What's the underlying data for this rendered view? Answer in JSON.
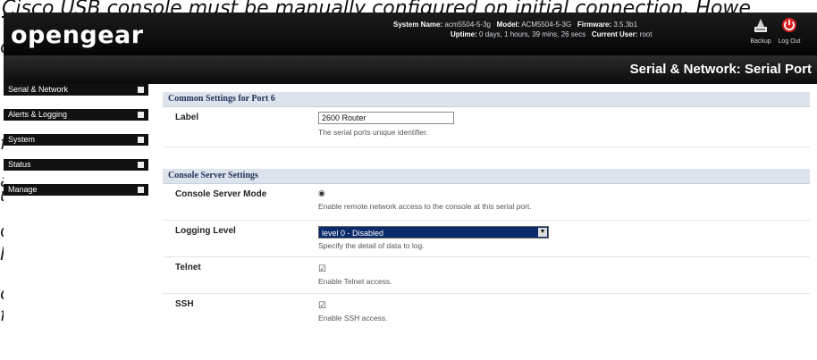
{
  "background_doc": {
    "line1": "Cisco USB console must be manually configured on initial connection. Howe",
    "frag1": "c",
    "frag2": "f",
    "frag3": "a",
    "frag4": "u",
    "frag5": "o",
    "frag6": "I",
    "frag7": "c",
    "frag8": "f"
  },
  "header": {
    "logo": "opengear",
    "system_name_label": "System Name:",
    "system_name": "acm5504-5-3g",
    "model_label": "Model:",
    "model": "ACM5504-5-3G",
    "firmware_label": "Firmware:",
    "firmware": "3.5.3b1",
    "uptime_label": "Uptime:",
    "uptime": "0 days, 1 hours, 39 mins, 26 secs",
    "current_user_label": "Current User:",
    "current_user": "root",
    "backup_label": "Backup",
    "logout_label": "Log Out"
  },
  "title_bar": {
    "title": "Serial & Network: Serial Port"
  },
  "sidebar": {
    "items": [
      {
        "label": "Serial & Network"
      },
      {
        "label": "Alerts & Logging"
      },
      {
        "label": "System"
      },
      {
        "label": "Status"
      },
      {
        "label": "Manage"
      }
    ]
  },
  "common": {
    "heading": "Common Settings for Port 6",
    "label_label": "Label",
    "label_value": "2600 Router",
    "label_help": "The serial ports unique identifier."
  },
  "console": {
    "heading": "Console Server Settings",
    "mode_label": "Console Server Mode",
    "mode_help": "Enable remote network access to the console at this serial port.",
    "logging_label": "Logging Level",
    "logging_value": "level 0 - Disabled",
    "logging_help": "Specify the detail of data to log.",
    "telnet_label": "Telnet",
    "telnet_help": "Enable Telnet access.",
    "ssh_label": "SSH",
    "ssh_help": "Enable SSH access."
  },
  "colors": {
    "header_bg": "#0b0b0b",
    "section_bg": "#dde3ec",
    "select_bg": "#0a2a6a",
    "logout_icon": "#d92020"
  },
  "icons": {
    "backup": "backup-icon",
    "logout": "power-icon",
    "sidebar_expand": "expand-square-icon"
  }
}
